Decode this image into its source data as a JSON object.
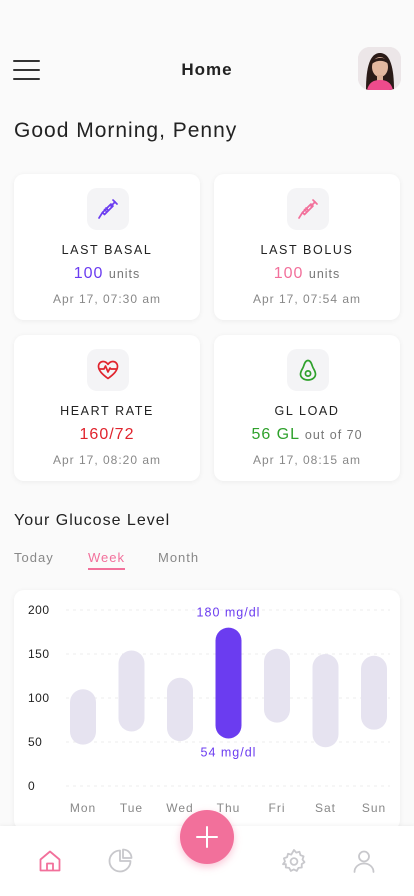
{
  "header": {
    "title": "Home",
    "menu_icon": "hamburger-menu-icon",
    "avatar": "user-avatar"
  },
  "greeting": "Good Morning, Penny",
  "cards": [
    {
      "icon": "syringe-icon",
      "label": "LAST BASAL",
      "value": "100",
      "unit": "units",
      "time": "Apr 17, 07:30 am",
      "color": "#6b3cf0"
    },
    {
      "icon": "syringe-icon",
      "label": "LAST BOLUS",
      "value": "100",
      "unit": "units",
      "time": "Apr 17, 07:54 am",
      "color": "#f2709b"
    },
    {
      "icon": "heart-rate-icon",
      "label": "HEART RATE",
      "value": "160/72",
      "unit": "",
      "time": "Apr 17, 08:20 am",
      "color": "#e0242d"
    },
    {
      "icon": "avocado-icon",
      "label": "GL LOAD",
      "value": "56 GL",
      "unit": "out of 70",
      "time": "Apr 17, 08:15 am",
      "color": "#2fa12c"
    }
  ],
  "glucose": {
    "title": "Your Glucose Level",
    "tabs": [
      {
        "label": "Today",
        "active": false
      },
      {
        "label": "Week",
        "active": true
      },
      {
        "label": "Month",
        "active": false
      }
    ]
  },
  "chart_data": {
    "type": "bar",
    "subtype": "range",
    "categories": [
      "Mon",
      "Tue",
      "Wed",
      "Thu",
      "Fri",
      "Sat",
      "Sun"
    ],
    "series": [
      {
        "low": [
          47,
          62,
          51,
          54,
          72,
          44,
          64
        ],
        "high": [
          110,
          154,
          123,
          180,
          156,
          150,
          148
        ]
      }
    ],
    "highlight": {
      "category": "Thu",
      "high_label": "180 mg/dl",
      "low_label": "54 mg/dl"
    },
    "ylim": [
      0,
      200
    ],
    "yticks": [
      0,
      50,
      100,
      150,
      200
    ],
    "grid": true,
    "colors": {
      "bar": "#e6e3f0",
      "highlight": "#6b3cf0",
      "label": "#6b3cf0"
    }
  },
  "nav": {
    "items": [
      {
        "icon": "home-icon",
        "active": true
      },
      {
        "icon": "pie-chart-icon",
        "active": false
      },
      {
        "icon": "settings-icon",
        "active": false
      },
      {
        "icon": "profile-icon",
        "active": false
      }
    ],
    "add_icon": "plus-icon",
    "accent": "#f2709b"
  }
}
